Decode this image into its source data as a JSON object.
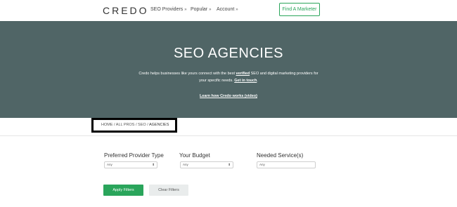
{
  "header": {
    "logo": "CREDO",
    "nav": [
      {
        "label": "SEO Providers",
        "caret": "»"
      },
      {
        "label": "Popular",
        "caret": "»"
      },
      {
        "label": "Account",
        "caret": "»"
      }
    ],
    "cta_label": "Find A Marketer"
  },
  "hero": {
    "title": "SEO AGENCIES",
    "desc_before": "Credo helps businesses like yours connect with the best ",
    "desc_verified": "verified",
    "desc_after": " SEO and digital marketing providers for your specific needs. ",
    "desc_get_in_touch": "Get in touch",
    "desc_end": ".",
    "video_link": "Learn how Credo works (video)",
    "background_color": "#506566"
  },
  "breadcrumb": {
    "path": "HOME / ALL PROS / SEO / ",
    "current": "AGENCIES"
  },
  "filters": {
    "provider_type": {
      "label": "Preferred Provider Type",
      "value": "Any",
      "arrow": "⬍"
    },
    "budget": {
      "label": "Your Budget",
      "value": "Any",
      "arrow": "⬍"
    },
    "services": {
      "label": "Needed Service(s)",
      "value": "Any"
    }
  },
  "buttons": {
    "apply": "Apply Filters",
    "clear": "Clear Filters",
    "accent_color": "#2aa55b"
  }
}
